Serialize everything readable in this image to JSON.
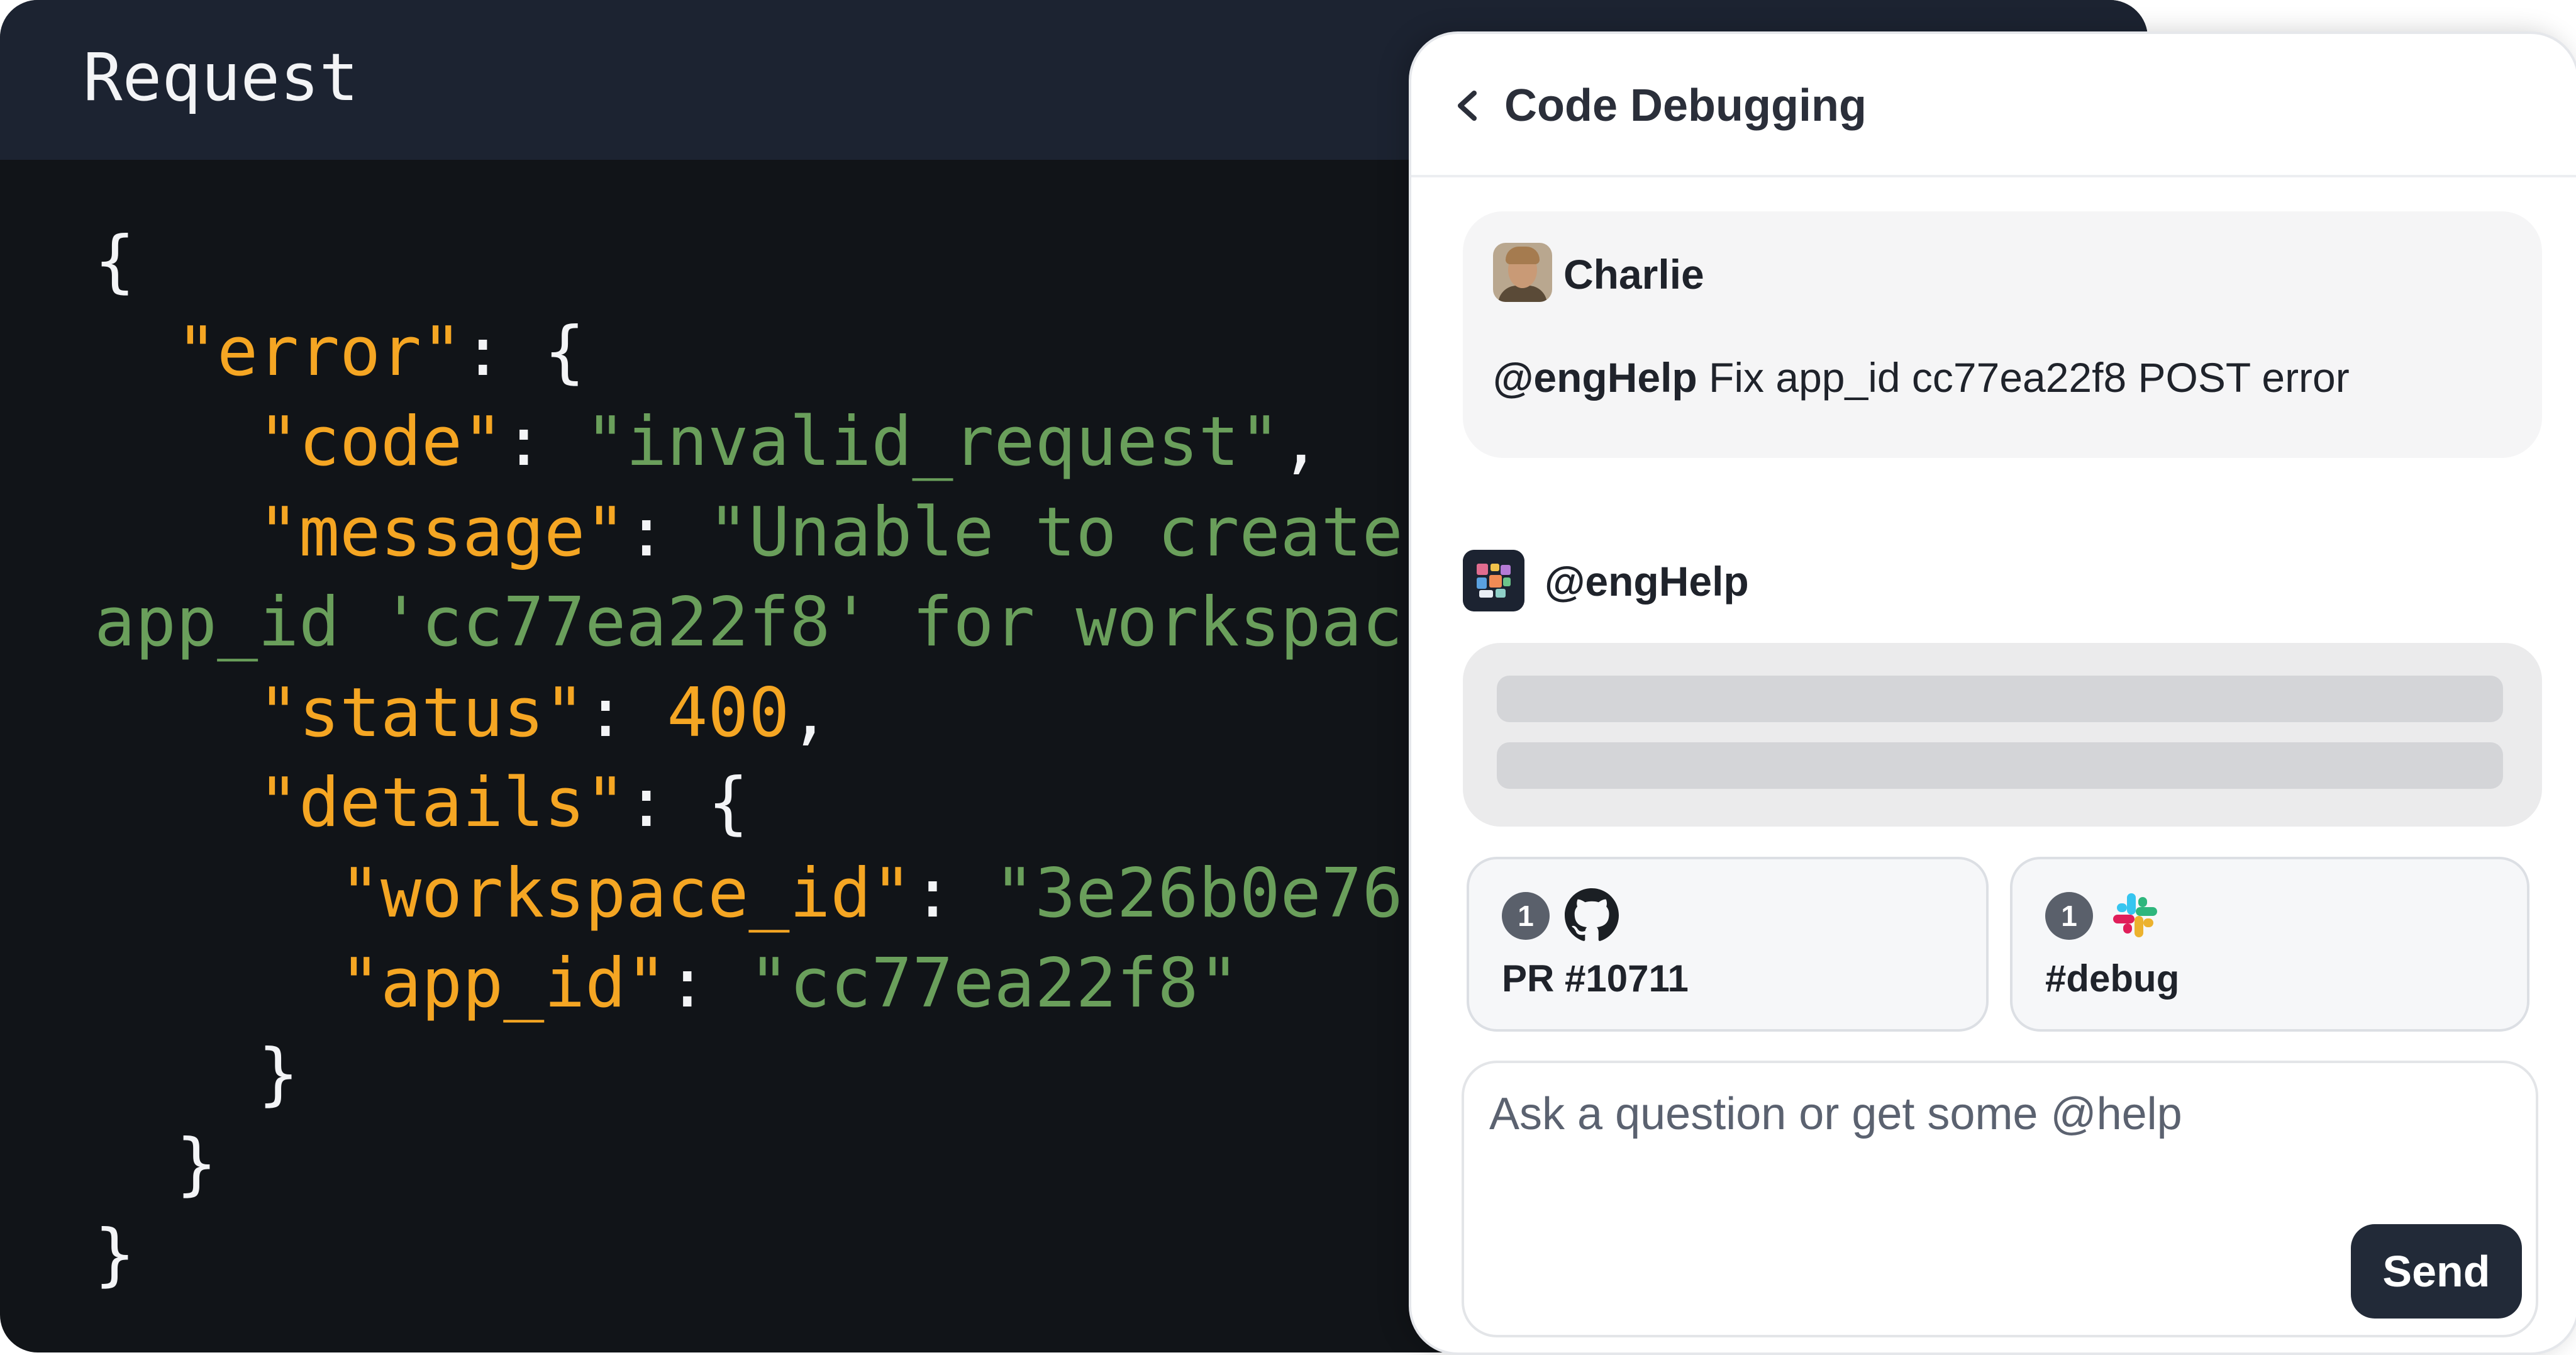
{
  "code_panel": {
    "title": "Request",
    "lines": [
      [
        {
          "t": "{",
          "c": "pun"
        }
      ],
      [
        {
          "t": "  ",
          "c": "pun"
        },
        {
          "t": "\"error\"",
          "c": "key"
        },
        {
          "t": ": {",
          "c": "pun"
        }
      ],
      [
        {
          "t": "    ",
          "c": "pun"
        },
        {
          "t": "\"code\"",
          "c": "key"
        },
        {
          "t": ": ",
          "c": "pun"
        },
        {
          "t": "\"invalid_request\"",
          "c": "str"
        },
        {
          "t": ",",
          "c": "pun"
        }
      ],
      [
        {
          "t": "    ",
          "c": "pun"
        },
        {
          "t": "\"message\"",
          "c": "key"
        },
        {
          "t": ": ",
          "c": "pun"
        },
        {
          "t": "\"Unable to create",
          "c": "str"
        }
      ],
      [
        {
          "t": "app_id 'cc77ea22f8' for workspac",
          "c": "str"
        }
      ],
      [
        {
          "t": "    ",
          "c": "pun"
        },
        {
          "t": "\"status\"",
          "c": "key"
        },
        {
          "t": ": ",
          "c": "pun"
        },
        {
          "t": "400",
          "c": "num"
        },
        {
          "t": ",",
          "c": "pun"
        }
      ],
      [
        {
          "t": "    ",
          "c": "pun"
        },
        {
          "t": "\"details\"",
          "c": "key"
        },
        {
          "t": ": {",
          "c": "pun"
        }
      ],
      [
        {
          "t": "      ",
          "c": "pun"
        },
        {
          "t": "\"workspace_id\"",
          "c": "key"
        },
        {
          "t": ": ",
          "c": "pun"
        },
        {
          "t": "\"3e26b0e76",
          "c": "str"
        }
      ],
      [
        {
          "t": "      ",
          "c": "pun"
        },
        {
          "t": "\"app_id\"",
          "c": "key"
        },
        {
          "t": ": ",
          "c": "pun"
        },
        {
          "t": "\"cc77ea22f8\"",
          "c": "str"
        }
      ],
      [
        {
          "t": "    }",
          "c": "pun"
        }
      ],
      [
        {
          "t": "  }",
          "c": "pun"
        }
      ],
      [
        {
          "t": "}",
          "c": "pun"
        }
      ]
    ]
  },
  "chat": {
    "title": "Code Debugging",
    "message": {
      "author": "Charlie",
      "mention": "@engHelp",
      "text": " Fix app_id cc77ea22f8 POST error"
    },
    "bot": {
      "name": "@engHelp"
    },
    "sources": [
      {
        "count": "1",
        "icon": "github-icon",
        "label": "PR #10711"
      },
      {
        "count": "1",
        "icon": "slack-icon",
        "label": "#debug"
      }
    ],
    "input": {
      "placeholder": "Ask a question or get some @help",
      "value": ""
    },
    "send_label": "Send"
  },
  "colors": {
    "code_background": "#111418",
    "code_header": "#1c2331",
    "json_key": "#f5a623",
    "json_string": "#6a9f5b",
    "send_button": "#222a38"
  }
}
